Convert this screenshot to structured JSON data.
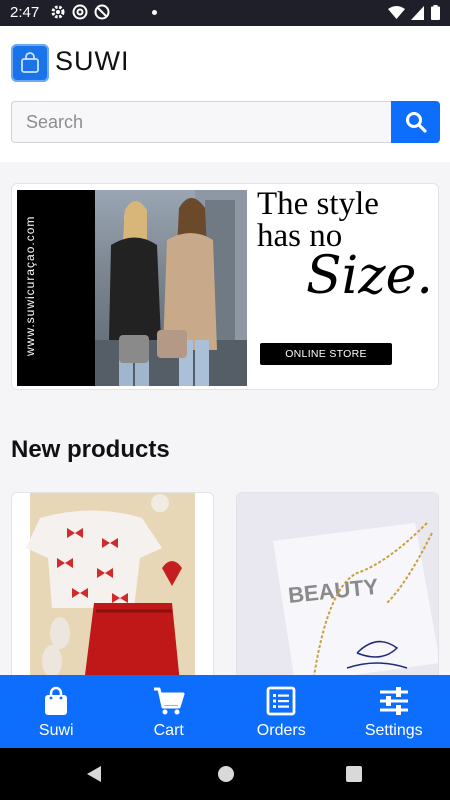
{
  "status_bar": {
    "time": "2:47"
  },
  "header": {
    "brand": "SUWI"
  },
  "search": {
    "placeholder": "Search"
  },
  "banner": {
    "url_text": "www.suwicuraçao.com",
    "headline_line1": "The style",
    "headline_line2": "has no",
    "script_word": "Size.",
    "button_label": "ONLINE STORE"
  },
  "products_section": {
    "title": "New products"
  },
  "products": [
    {
      "name": "",
      "image": "red-bow-outfit"
    },
    {
      "name": "",
      "image": "beauty-necklace",
      "image_text": "BEAUTY"
    }
  ],
  "bottom_nav": {
    "items": [
      {
        "label": "Suwi",
        "icon": "bag-icon"
      },
      {
        "label": "Cart",
        "icon": "cart-icon"
      },
      {
        "label": "Orders",
        "icon": "list-icon"
      },
      {
        "label": "Settings",
        "icon": "sliders-icon"
      }
    ]
  },
  "colors": {
    "accent": "#0d6efd",
    "status_bar": "#1f1f2a"
  }
}
